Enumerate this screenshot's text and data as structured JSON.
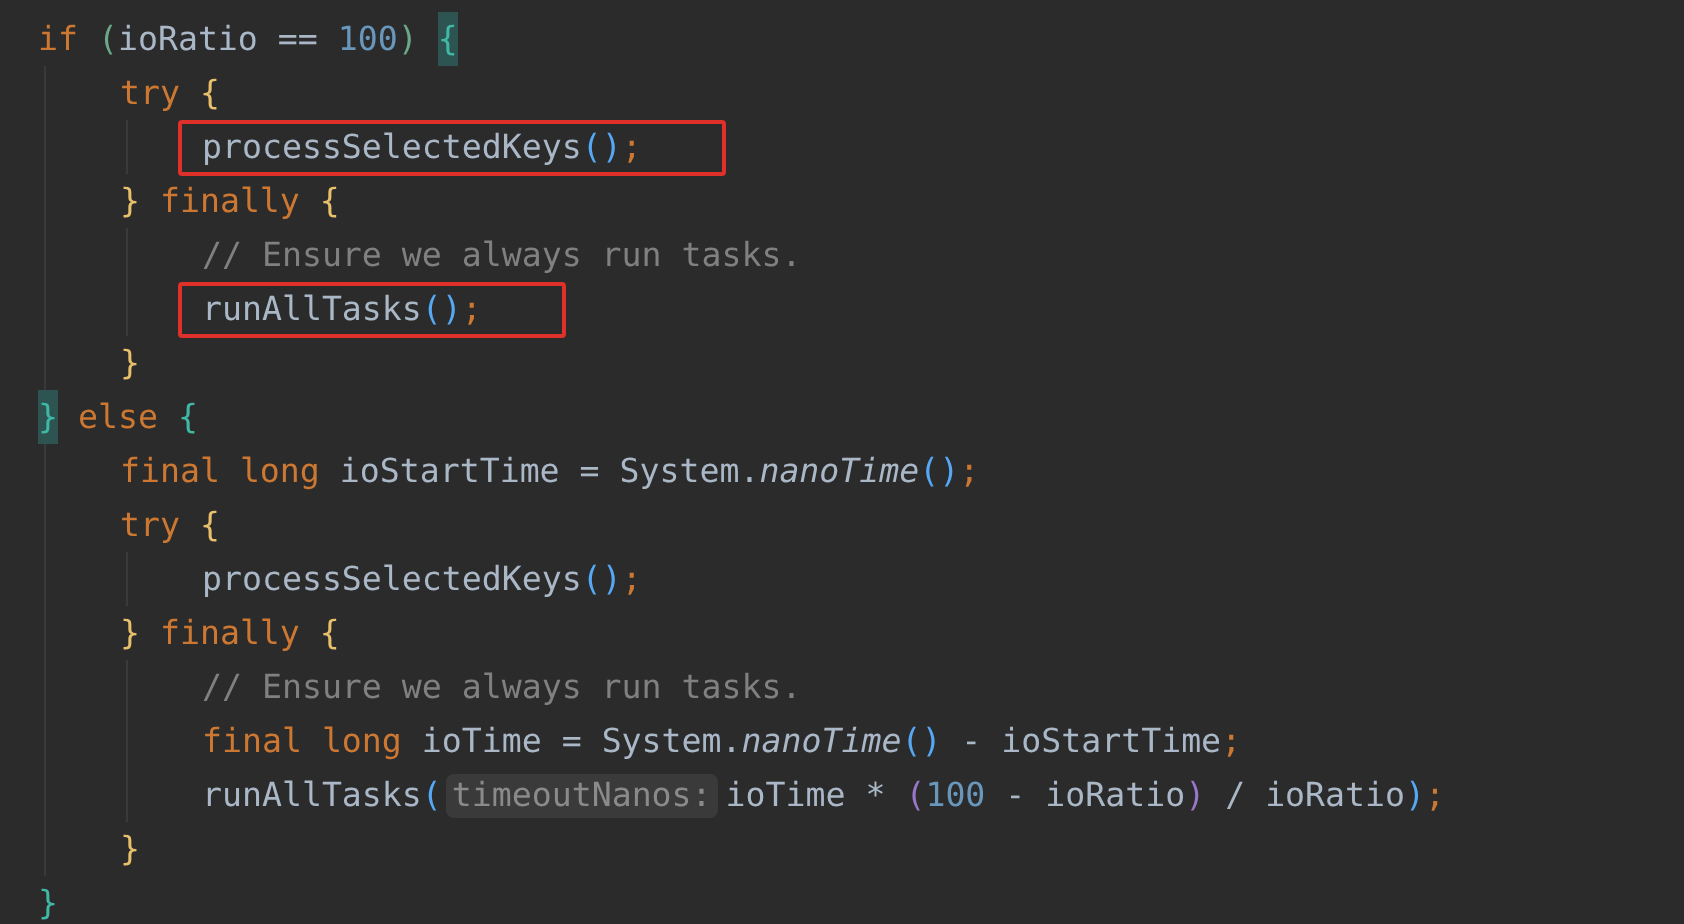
{
  "editor": {
    "lines": [
      {
        "highlighted": false,
        "tokens": [
          {
            "kind": "keyword",
            "text": "if "
          },
          {
            "kind": "bracket",
            "text": "(",
            "color": "#6aa88a"
          },
          {
            "kind": "identifier",
            "text": "ioRatio "
          },
          {
            "kind": "operator",
            "text": "== "
          },
          {
            "kind": "number",
            "text": "100"
          },
          {
            "kind": "bracket",
            "text": ") ",
            "color": "#6aa88a"
          },
          {
            "kind": "brace-match",
            "text": "{"
          }
        ],
        "children": [
          {
            "highlighted": false,
            "tokens": [
              {
                "kind": "keyword",
                "text": "try "
              },
              {
                "kind": "bracket",
                "text": "{",
                "color": "#e8bf6a"
              }
            ],
            "children": [
              {
                "highlighted": true,
                "tokens": [
                  {
                    "kind": "method",
                    "text": "processSelectedKeys"
                  },
                  {
                    "kind": "bracket",
                    "text": "()",
                    "color": "#56a8f5"
                  },
                  {
                    "kind": "semicolon",
                    "text": ";"
                  }
                ]
              }
            ]
          },
          {
            "highlighted": false,
            "tokens": [
              {
                "kind": "bracket",
                "text": "} ",
                "color": "#e8bf6a"
              },
              {
                "kind": "keyword",
                "text": "finally "
              },
              {
                "kind": "bracket",
                "text": "{",
                "color": "#e8bf6a"
              }
            ],
            "children": [
              {
                "highlighted": false,
                "tokens": [
                  {
                    "kind": "comment",
                    "text": "// Ensure we always run tasks."
                  }
                ]
              },
              {
                "highlighted": true,
                "tokens": [
                  {
                    "kind": "method",
                    "text": "runAllTasks"
                  },
                  {
                    "kind": "bracket",
                    "text": "()",
                    "color": "#56a8f5"
                  },
                  {
                    "kind": "semicolon",
                    "text": ";"
                  }
                ]
              }
            ]
          },
          {
            "highlighted": false,
            "tokens": [
              {
                "kind": "bracket",
                "text": "}",
                "color": "#e8bf6a"
              }
            ]
          }
        ]
      },
      {
        "highlighted": false,
        "tokens": [
          {
            "kind": "brace-match",
            "text": "}"
          },
          {
            "kind": "keyword",
            "text": " else "
          },
          {
            "kind": "bracket",
            "text": "{",
            "color": "#3fb8a6"
          }
        ],
        "children": [
          {
            "highlighted": false,
            "tokens": [
              {
                "kind": "keyword",
                "text": "final long "
              },
              {
                "kind": "identifier",
                "text": "ioStartTime = System."
              },
              {
                "kind": "static-call",
                "text": "nanoTime"
              },
              {
                "kind": "bracket",
                "text": "()",
                "color": "#56a8f5"
              },
              {
                "kind": "semicolon",
                "text": ";"
              }
            ]
          },
          {
            "highlighted": false,
            "tokens": [
              {
                "kind": "keyword",
                "text": "try "
              },
              {
                "kind": "bracket",
                "text": "{",
                "color": "#e8bf6a"
              }
            ],
            "children": [
              {
                "highlighted": false,
                "tokens": [
                  {
                    "kind": "method",
                    "text": "processSelectedKeys"
                  },
                  {
                    "kind": "bracket",
                    "text": "()",
                    "color": "#56a8f5"
                  },
                  {
                    "kind": "semicolon",
                    "text": ";"
                  }
                ]
              }
            ]
          },
          {
            "highlighted": false,
            "tokens": [
              {
                "kind": "bracket",
                "text": "} ",
                "color": "#e8bf6a"
              },
              {
                "kind": "keyword",
                "text": "finally "
              },
              {
                "kind": "bracket",
                "text": "{",
                "color": "#e8bf6a"
              }
            ],
            "children": [
              {
                "highlighted": false,
                "tokens": [
                  {
                    "kind": "comment",
                    "text": "// Ensure we always run tasks."
                  }
                ]
              },
              {
                "highlighted": false,
                "tokens": [
                  {
                    "kind": "keyword",
                    "text": "final long "
                  },
                  {
                    "kind": "identifier",
                    "text": "ioTime = System."
                  },
                  {
                    "kind": "static-call",
                    "text": "nanoTime"
                  },
                  {
                    "kind": "bracket",
                    "text": "()",
                    "color": "#56a8f5"
                  },
                  {
                    "kind": "identifier",
                    "text": " - ioStartTime"
                  },
                  {
                    "kind": "semicolon",
                    "text": ";"
                  }
                ]
              },
              {
                "highlighted": false,
                "tokens": [
                  {
                    "kind": "method",
                    "text": "runAllTasks"
                  },
                  {
                    "kind": "bracket",
                    "text": "(",
                    "color": "#56a8f5"
                  },
                  {
                    "kind": "hint",
                    "text": "timeoutNanos:"
                  },
                  {
                    "kind": "identifier",
                    "text": "ioTime * "
                  },
                  {
                    "kind": "bracket",
                    "text": "(",
                    "color": "#9876c8"
                  },
                  {
                    "kind": "number",
                    "text": "100"
                  },
                  {
                    "kind": "identifier",
                    "text": " - ioRatio"
                  },
                  {
                    "kind": "bracket",
                    "text": ")",
                    "color": "#9876c8"
                  },
                  {
                    "kind": "identifier",
                    "text": " / ioRatio"
                  },
                  {
                    "kind": "bracket",
                    "text": ")",
                    "color": "#56a8f5"
                  },
                  {
                    "kind": "semicolon",
                    "text": ";"
                  }
                ]
              }
            ]
          },
          {
            "highlighted": false,
            "tokens": [
              {
                "kind": "bracket",
                "text": "}",
                "color": "#e8bf6a"
              }
            ]
          }
        ]
      },
      {
        "highlighted": false,
        "tokens": [
          {
            "kind": "bracket",
            "text": "}",
            "color": "#3fb8a6"
          }
        ]
      }
    ]
  }
}
